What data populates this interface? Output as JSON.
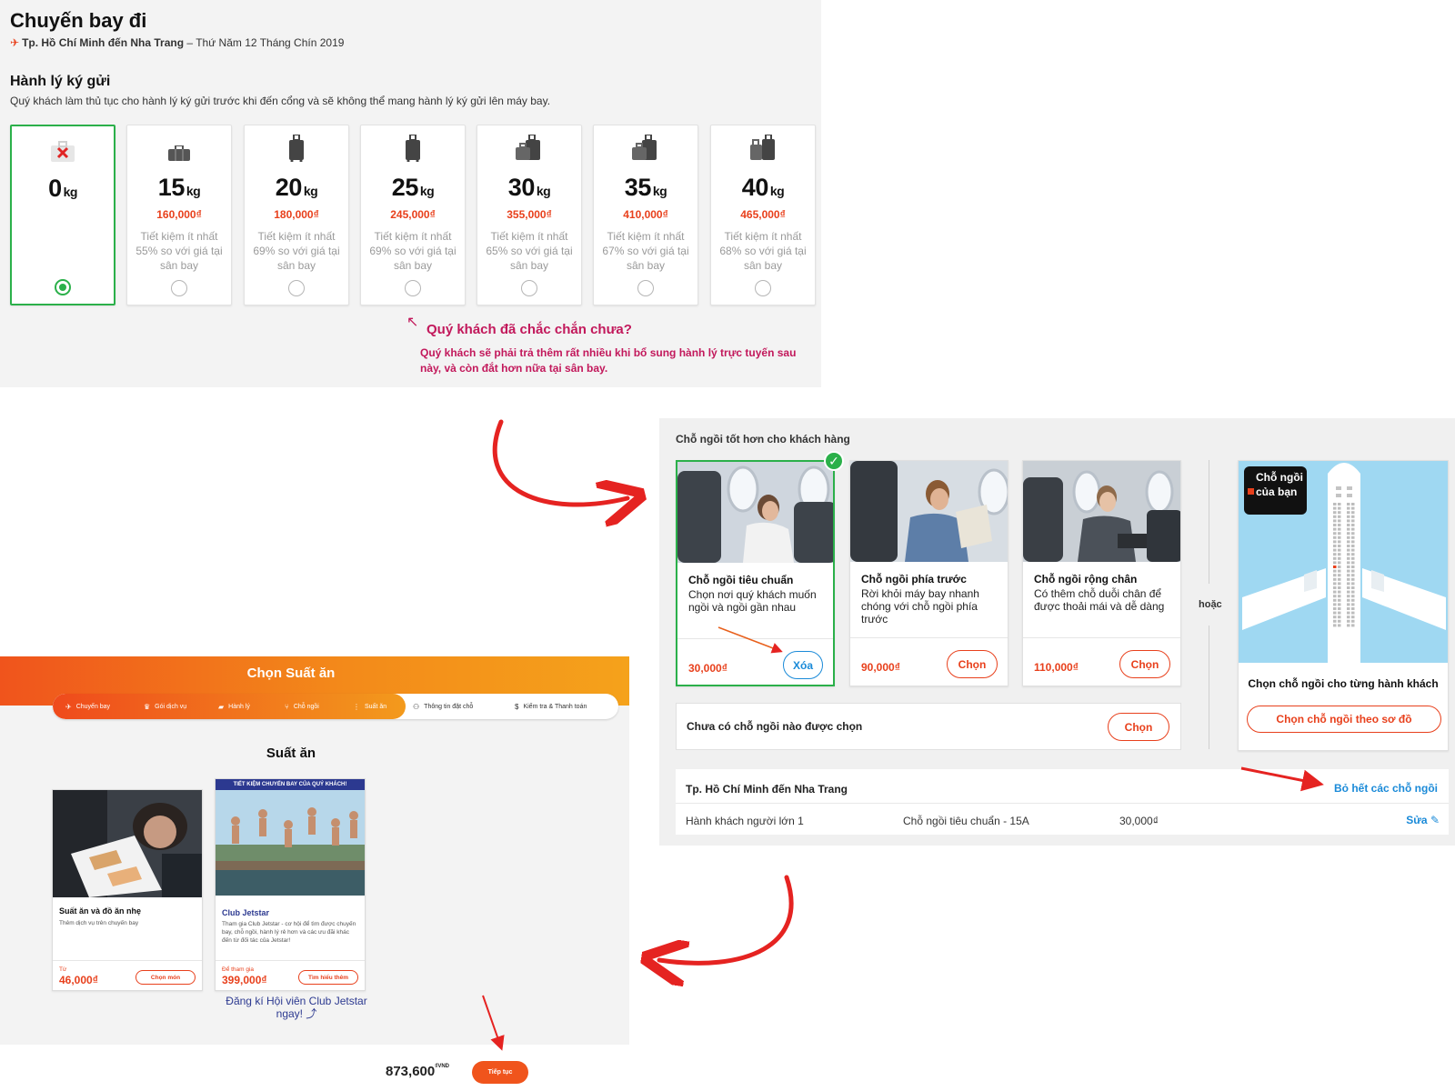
{
  "flight": {
    "title": "Chuyến bay đi",
    "route": "Tp. Hồ Chí Minh đến Nha Trang",
    "date": " – Thứ Năm 12 Tháng Chín 2019"
  },
  "baggage": {
    "heading": "Hành lý ký gửi",
    "description": "Quý khách làm thủ tục cho hành lý ký gửi trước khi đến cổng và sẽ không thể mang hành lý ký gửi lên máy bay.",
    "unit": "kg",
    "options": [
      {
        "weight": "0",
        "price": "",
        "saving": "",
        "selected": true,
        "icon": "no-baggage-icon"
      },
      {
        "weight": "15",
        "price": "160,000₫",
        "saving": "Tiết kiệm ít nhất 55% so với giá tại sân bay",
        "selected": false,
        "icon": "bag-small-icon"
      },
      {
        "weight": "20",
        "price": "180,000₫",
        "saving": "Tiết kiệm ít nhất 69% so với giá tại sân bay",
        "selected": false,
        "icon": "suitcase-icon"
      },
      {
        "weight": "25",
        "price": "245,000₫",
        "saving": "Tiết kiệm ít nhất 69% so với giá tại sân bay",
        "selected": false,
        "icon": "suitcase-icon"
      },
      {
        "weight": "30",
        "price": "355,000₫",
        "saving": "Tiết kiệm ít nhất 65% so với giá tại sân bay",
        "selected": false,
        "icon": "two-bags-icon"
      },
      {
        "weight": "35",
        "price": "410,000₫",
        "saving": "Tiết kiệm ít nhất 67% so với giá tại sân bay",
        "selected": false,
        "icon": "two-bags-icon"
      },
      {
        "weight": "40",
        "price": "465,000₫",
        "saving": "Tiết kiệm ít nhất 68% so với giá tại sân bay",
        "selected": false,
        "icon": "two-suitcases-icon"
      }
    ],
    "warning_title": "Quý khách đã chắc chắn chưa?",
    "warning_text": "Quý khách sẽ phải trả thêm rất nhiều khi bổ sung hành lý trực tuyến sau này, và còn đắt hơn nữa tại sân bay."
  },
  "seats": {
    "heading": "Chỗ ngồi tốt hơn cho khách hàng",
    "options": [
      {
        "title": "Chỗ ngồi tiêu chuẩn",
        "desc": "Chọn nơi quý khách muốn ngồi và ngồi gần nhau",
        "price": "30,000₫",
        "button": "Xóa",
        "selected": true
      },
      {
        "title": "Chỗ ngồi phía trước",
        "desc": "Rời khỏi máy bay nhanh chóng với chỗ ngồi phía trước",
        "price": "90,000₫",
        "button": "Chọn",
        "selected": false
      },
      {
        "title": "Chỗ ngồi rộng chân",
        "desc": "Có thêm chỗ duỗi chân để được thoải mái và dễ dàng",
        "price": "110,000₫",
        "button": "Chọn",
        "selected": false
      }
    ],
    "or_label": "hoặc",
    "no_seat_text": "Chưa có chỗ ngồi nào được chọn",
    "no_seat_button": "Chọn",
    "map_badge": "Chỗ ngồi của bạn",
    "map_caption": "Chọn chỗ ngồi cho từng hành khách",
    "map_button": "Chọn chỗ ngồi theo sơ đồ",
    "summary": {
      "route": "Tp. Hồ Chí Minh đến Nha Trang",
      "clear_all": "Bỏ hết các chỗ ngồi",
      "passenger": "Hành khách người lớn 1",
      "seat": "Chỗ ngồi tiêu chuẩn - 15A",
      "price": "30,000₫",
      "edit": "Sửa"
    }
  },
  "meals": {
    "header_title": "Chọn Suất ăn",
    "steps": [
      {
        "label": "Chuyến bay",
        "icon": "plane-icon"
      },
      {
        "label": "Gói dịch vụ",
        "icon": "crown-icon"
      },
      {
        "label": "Hành lý",
        "icon": "baggage-icon"
      },
      {
        "label": "Chỗ ngồi",
        "icon": "seat-icon"
      },
      {
        "label": "Suất ăn",
        "icon": "meal-icon"
      },
      {
        "label": "Thông tin đặt chỗ",
        "icon": "person-icon"
      },
      {
        "label": "Kiểm tra & Thanh toán",
        "icon": "dollar-icon"
      }
    ],
    "title": "Suất ăn",
    "cards": [
      {
        "title": "Suất ăn và đồ ăn nhẹ",
        "desc": "Thêm dịch vụ trên chuyến bay",
        "price_prefix": "Từ",
        "price": "46,000₫",
        "button": "Chọn món"
      },
      {
        "banner": "TIẾT KIỆM CHUYẾN BAY CỦA QUÝ KHÁCH!",
        "title": "Club Jetstar",
        "desc": "Tham gia Club Jetstar - cơ hội để tìm được chuyến bay, chỗ ngồi, hành lý rẻ hơn và các ưu đãi khác đến từ đối tác của Jetstar!",
        "price_prefix": "Để tham gia",
        "price": "399,000₫",
        "button": "Tìm hiểu thêm"
      }
    ],
    "club_join": "Đăng kí Hội viên Club Jetstar ngay!",
    "total": "873,600",
    "currency": "₫VND",
    "continue": "Tiếp tục"
  },
  "colors": {
    "accent": "#e8401c",
    "selected_green": "#2bb04a",
    "link_blue": "#1a8ad8",
    "warning": "#c2185b",
    "flow_arrow": "#e52321"
  }
}
